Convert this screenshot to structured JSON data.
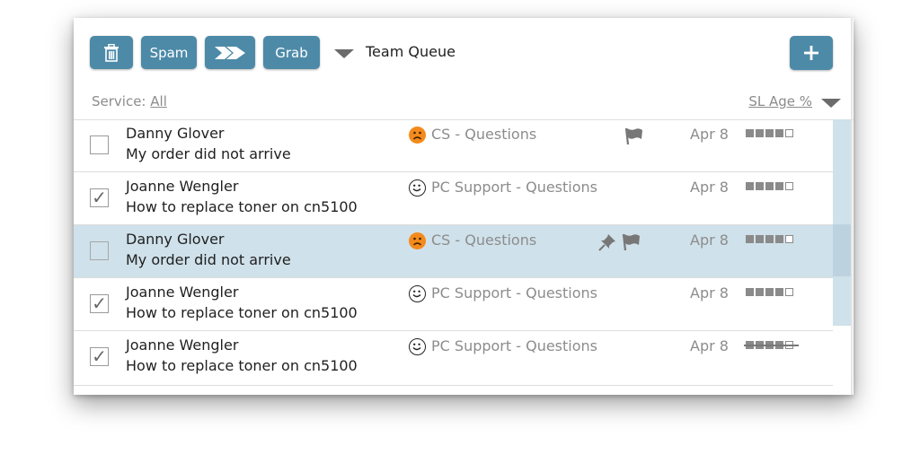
{
  "toolbar": {
    "delete_icon": "trash-icon",
    "spam_label": "Spam",
    "forward_icon": "double-arrow-forward-icon",
    "grab_label": "Grab",
    "queue_dropdown_icon": "triangle-down-icon",
    "queue_label": "Team Queue",
    "add_icon": "plus-icon",
    "accent_color": "#4d8aa8"
  },
  "filter": {
    "service_prefix": "Service:",
    "service_value": "All",
    "sort_label": "SL Age %",
    "sort_icon": "triangle-down-icon"
  },
  "rows": [
    {
      "name": "Danny Glover",
      "subject": "My order did not arrive",
      "checked": "",
      "mood_icon": "frown-face-icon",
      "service": "CS - Questions",
      "flag_icon": "flag-icon",
      "date": "Apr 8",
      "age_filled": 4,
      "age_total": 5
    },
    {
      "name": "Joanne Wengler",
      "subject": "How to replace toner on cn5100",
      "checked": "✓",
      "mood_icon": "smile-face-icon",
      "service": "PC Support - Questions",
      "date": "Apr 8",
      "age_filled": 4,
      "age_total": 5
    },
    {
      "name": "Danny Glover",
      "subject": "My order did not arrive",
      "checked": "",
      "mood_icon": "frown-face-icon",
      "service": "CS - Questions",
      "pin_icon": "pin-icon",
      "flag_icon": "flag-icon",
      "date": "Apr 8",
      "age_filled": 4,
      "age_total": 5,
      "selected": true
    },
    {
      "name": "Joanne Wengler",
      "subject": "How to replace toner on cn5100",
      "checked": "✓",
      "mood_icon": "smile-face-icon",
      "service": "PC Support - Questions",
      "date": "Apr 8",
      "age_filled": 4,
      "age_total": 5
    },
    {
      "name": "Joanne Wengler",
      "subject": "How to replace toner on cn5100",
      "checked": "✓",
      "mood_icon": "smile-face-icon",
      "service": "PC Support - Questions",
      "date": "Apr 8",
      "age_filled": 4,
      "age_total": 5,
      "age_struck": true
    }
  ],
  "colors": {
    "selected_row": "#cfe1ea",
    "sad_face": "#f48a1b",
    "muted_text": "#8c8c8c"
  }
}
